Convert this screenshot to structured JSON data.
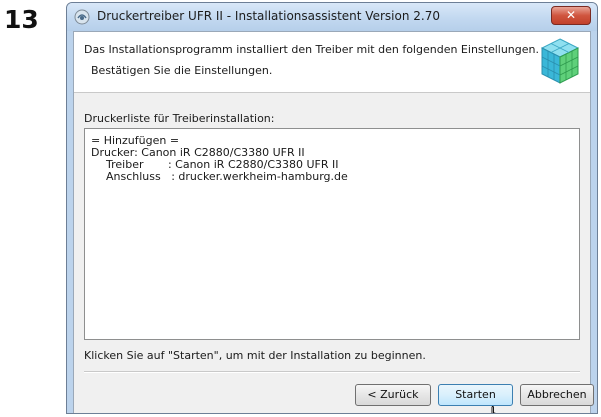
{
  "step": {
    "number": "13"
  },
  "window": {
    "title": "Druckertreiber UFR II - Installationsassistent Version 2.70",
    "close_label": "✕"
  },
  "header": {
    "line1": "Das Installationsprogramm installiert den Treiber mit den folgenden Einstellungen.",
    "line2": "Bestätigen Sie die Einstellungen."
  },
  "list": {
    "label": "Druckerliste für Treiberinstallation:",
    "lines": [
      "= Hinzufügen =",
      "Drucker: Canon iR C2880/C3380 UFR II",
      "Treiber       : Canon iR C2880/C3380 UFR II",
      "Anschluss   : drucker.werkheim-hamburg.de"
    ]
  },
  "footer": {
    "prompt": "Klicken Sie auf \"Starten\", um mit der Installation zu beginnen.",
    "back_label": "< Zurück",
    "start_label": "Starten",
    "cancel_label": "Abbrechen"
  },
  "colors": {
    "title_bar": "#c2d8f0",
    "close_button": "#c94a34",
    "client_bg": "#f0f0f0",
    "default_button_border": "#3c7fb1"
  },
  "icons": {
    "app": "printer-driver-icon",
    "header": "cube-stack-icon",
    "cursor": "mouse-pointer-icon"
  }
}
